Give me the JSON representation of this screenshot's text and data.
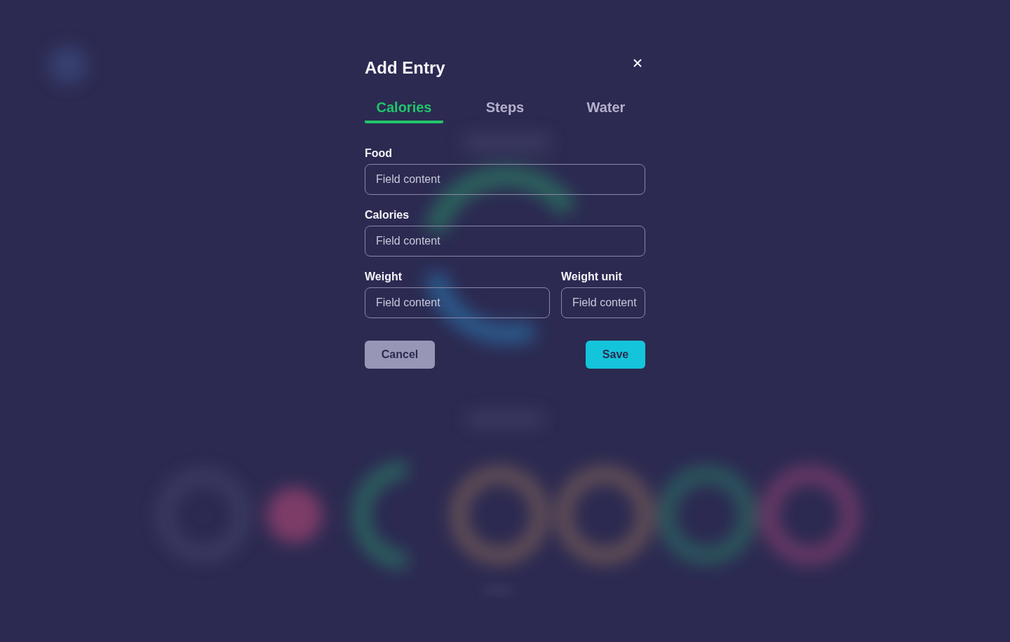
{
  "dialog": {
    "title": "Add Entry"
  },
  "tabs": [
    {
      "label": "Calories",
      "selected": true
    },
    {
      "label": "Steps",
      "selected": false
    },
    {
      "label": "Water",
      "selected": false
    }
  ],
  "form_rows": [
    [
      {
        "label": "Food",
        "placeholder": "Field content"
      }
    ],
    [
      {
        "label": "Calories",
        "placeholder": "Field content"
      }
    ],
    [
      {
        "label": "Weight",
        "placeholder": "Field content"
      },
      {
        "label": "Weight unit",
        "placeholder": "Field content"
      }
    ]
  ],
  "buttons": [
    {
      "label": "Cancel",
      "kind": "secondary"
    },
    {
      "label": "Save",
      "kind": "primary"
    }
  ]
}
